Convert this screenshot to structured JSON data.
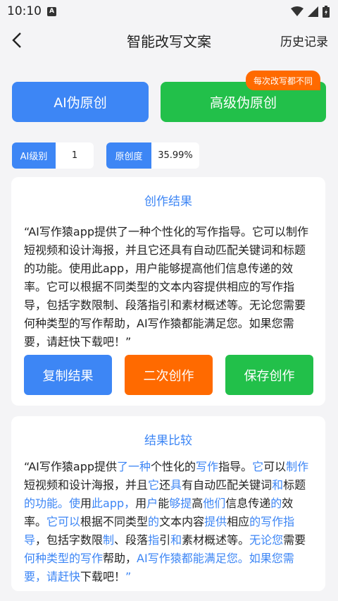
{
  "status": {
    "time": "10:10",
    "notif": "A"
  },
  "appbar": {
    "title": "智能改写文案",
    "history": "历史记录"
  },
  "modes": {
    "ai_label": "AI伪原创",
    "advanced_label": "高级伪原创",
    "badge": "每次改写都不同"
  },
  "stats": {
    "level_label": "AI级别",
    "level_value": "1",
    "orig_label": "原创度",
    "orig_value": "35.99%"
  },
  "result": {
    "title": "创作结果",
    "text": "“AI写作猿app提供了一种个性化的写作指导。它可以制作短视频和设计海报，并且它还具有自动匹配关键词和标题的功能。使用此app，用户能够提高他们信息传递的效率。它可以根据不同类型的文本内容提供相应的写作指导，包括字数限制、段落指引和素材概述等。无论您需要何种类型的写作帮助，AI写作猿都能满足您。如果您需要，请赶快下载吧！”",
    "copy_label": "复制结果",
    "again_label": "二次创作",
    "save_label": "保存创作"
  },
  "compare": {
    "title": "结果比较",
    "segments": [
      {
        "t": "“AI写作猿app提供",
        "h": false
      },
      {
        "t": "了一种",
        "h": true
      },
      {
        "t": "个性化的",
        "h": false
      },
      {
        "t": "写作",
        "h": true
      },
      {
        "t": "指导。",
        "h": false
      },
      {
        "t": "它",
        "h": true
      },
      {
        "t": "可以",
        "h": false
      },
      {
        "t": "制作",
        "h": true
      },
      {
        "t": "短视频和设计海报，并且",
        "h": false
      },
      {
        "t": "它",
        "h": true
      },
      {
        "t": "还",
        "h": false
      },
      {
        "t": "具",
        "h": true
      },
      {
        "t": "有自动匹配关键词",
        "h": false
      },
      {
        "t": "和",
        "h": true
      },
      {
        "t": "标题",
        "h": false
      },
      {
        "t": "的功能。使",
        "h": true
      },
      {
        "t": "用",
        "h": false
      },
      {
        "t": "此app，",
        "h": true
      },
      {
        "t": "用",
        "h": false
      },
      {
        "t": "户",
        "h": true
      },
      {
        "t": "能",
        "h": false
      },
      {
        "t": "够提",
        "h": true
      },
      {
        "t": "高",
        "h": false
      },
      {
        "t": "他们",
        "h": true
      },
      {
        "t": "信息传递",
        "h": false
      },
      {
        "t": "的",
        "h": true
      },
      {
        "t": "效率。",
        "h": false
      },
      {
        "t": "它可以",
        "h": true
      },
      {
        "t": "根据不同类型",
        "h": false
      },
      {
        "t": "的",
        "h": true
      },
      {
        "t": "文本内容",
        "h": false
      },
      {
        "t": "提供",
        "h": true
      },
      {
        "t": "相应",
        "h": false
      },
      {
        "t": "的写作指导",
        "h": true
      },
      {
        "t": "，包括字数限",
        "h": false
      },
      {
        "t": "制",
        "h": true
      },
      {
        "t": "、段落",
        "h": false
      },
      {
        "t": "指",
        "h": true
      },
      {
        "t": "引",
        "h": false
      },
      {
        "t": "和",
        "h": true
      },
      {
        "t": "素材概述等。",
        "h": false
      },
      {
        "t": "无论您",
        "h": true
      },
      {
        "t": "需要",
        "h": false
      },
      {
        "t": "何种类型的写作",
        "h": true
      },
      {
        "t": "帮助，",
        "h": false
      },
      {
        "t": "AI写作猿都能满足您。如果您需要，请赶快",
        "h": true
      },
      {
        "t": "下载吧！",
        "h": false
      },
      {
        "t": "”",
        "h": true
      }
    ]
  }
}
